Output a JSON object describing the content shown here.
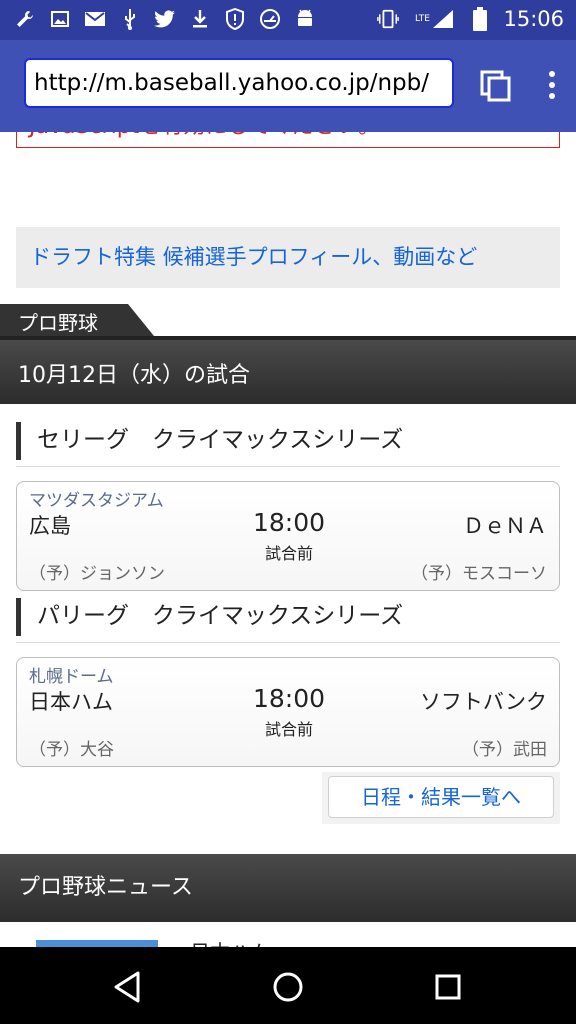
{
  "status_bar": {
    "time": "15:06",
    "network": "LTE",
    "left_icons": [
      "wrench-icon",
      "image-icon",
      "mail-icon",
      "usb-icon",
      "twitter-icon",
      "download-icon",
      "alert-shield-icon",
      "speedometer-icon",
      "android-icon"
    ],
    "right_icons": [
      "vibrate-icon",
      "lte-signal-icon",
      "battery-icon"
    ]
  },
  "browser": {
    "url": "http://m.baseball.yahoo.co.jp/npb/",
    "icons": [
      "tabs-icon",
      "overflow-menu-icon"
    ]
  },
  "page": {
    "warning_text": "JavaScriptを有効にしてください。",
    "draft_banner": "ドラフト特集  候補選手プロフィール、動画など",
    "section_tab": "プロ野球",
    "date_header": "10月12日（水）の試合",
    "leagues": [
      {
        "name": "セリーグ　クライマックスシリーズ",
        "game": {
          "venue": "マツダスタジアム",
          "home": "広島",
          "away": "ＤｅＮＡ",
          "time": "18:00",
          "state": "試合前",
          "home_pitcher": "（予）ジョンソン",
          "away_pitcher": "（予）モスコーソ"
        }
      },
      {
        "name": "パリーグ　クライマックスシリーズ",
        "game": {
          "venue": "札幌ドーム",
          "home": "日本ハム",
          "away": "ソフトバンク",
          "time": "18:00",
          "state": "試合前",
          "home_pitcher": "（予）大谷",
          "away_pitcher": "（予）武田"
        }
      }
    ],
    "schedule_link": "日程・結果一覧へ",
    "news_header": "プロ野球ニュース",
    "news_snippet": "日本ハム"
  },
  "nav": {
    "icons": [
      "back-icon",
      "home-icon",
      "recents-icon"
    ]
  }
}
